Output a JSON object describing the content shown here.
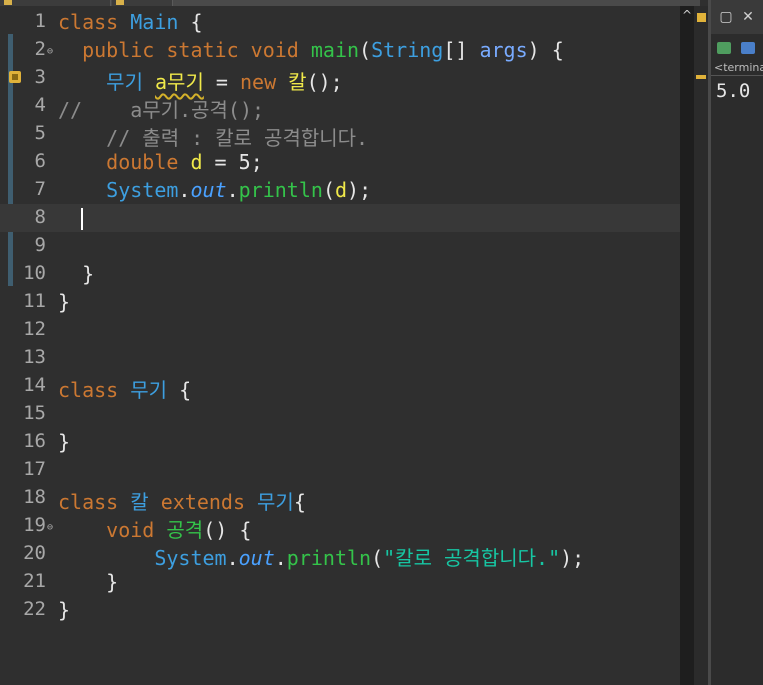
{
  "editor": {
    "lines": [
      {
        "n": "1",
        "tokens": [
          [
            "kw",
            "class "
          ],
          [
            "cls",
            "Main"
          ],
          [
            "",
            " {"
          ]
        ]
      },
      {
        "n": "2",
        "fold": true,
        "tokens": [
          [
            "",
            "  "
          ],
          [
            "kw",
            "public static void "
          ],
          [
            "fn",
            "main"
          ],
          [
            "",
            "("
          ],
          [
            "cls",
            "String"
          ],
          [
            "",
            "[] "
          ],
          [
            "param",
            "args"
          ],
          [
            "",
            ") {"
          ]
        ]
      },
      {
        "n": "3",
        "warn": true,
        "tokens": [
          [
            "",
            "    "
          ],
          [
            "cls",
            "무기 "
          ],
          [
            "var warn-ul",
            "a무기"
          ],
          [
            "",
            " = "
          ],
          [
            "kw",
            "new "
          ],
          [
            "var",
            "칼"
          ],
          [
            "",
            "();"
          ]
        ]
      },
      {
        "n": "4",
        "tokens": [
          [
            "cmt",
            "//    a무기.공격();"
          ]
        ]
      },
      {
        "n": "5",
        "tokens": [
          [
            "",
            "    "
          ],
          [
            "cmt",
            "// 출력 : 칼로 공격합니다."
          ]
        ]
      },
      {
        "n": "6",
        "tokens": [
          [
            "",
            "    "
          ],
          [
            "kw",
            "double "
          ],
          [
            "var",
            "d"
          ],
          [
            "",
            " = "
          ],
          [
            "num",
            "5"
          ],
          [
            "",
            ";"
          ]
        ]
      },
      {
        "n": "7",
        "tokens": [
          [
            "",
            "    "
          ],
          [
            "cls",
            "System"
          ],
          [
            "",
            "."
          ],
          [
            "fld",
            "out"
          ],
          [
            "",
            "."
          ],
          [
            "fn",
            "println"
          ],
          [
            "",
            "("
          ],
          [
            "var",
            "d"
          ],
          [
            "",
            ");"
          ]
        ]
      },
      {
        "n": "8",
        "current": true,
        "tokens": []
      },
      {
        "n": "9",
        "tokens": []
      },
      {
        "n": "10",
        "tokens": [
          [
            "",
            "  }"
          ]
        ]
      },
      {
        "n": "11",
        "tokens": [
          [
            "",
            "}"
          ]
        ]
      },
      {
        "n": "12",
        "tokens": []
      },
      {
        "n": "13",
        "tokens": []
      },
      {
        "n": "14",
        "tokens": [
          [
            "kw",
            "class "
          ],
          [
            "cls",
            "무기"
          ],
          [
            "",
            " {"
          ]
        ]
      },
      {
        "n": "15",
        "tokens": []
      },
      {
        "n": "16",
        "tokens": [
          [
            "",
            "}"
          ]
        ]
      },
      {
        "n": "17",
        "tokens": []
      },
      {
        "n": "18",
        "tokens": [
          [
            "kw",
            "class "
          ],
          [
            "cls",
            "칼"
          ],
          [
            "kw",
            " extends "
          ],
          [
            "cls",
            "무기"
          ],
          [
            "",
            "{"
          ]
        ]
      },
      {
        "n": "19",
        "fold": true,
        "tokens": [
          [
            "",
            "    "
          ],
          [
            "kw",
            "void "
          ],
          [
            "fn",
            "공격"
          ],
          [
            "",
            "() {"
          ]
        ]
      },
      {
        "n": "20",
        "tokens": [
          [
            "",
            "        "
          ],
          [
            "cls",
            "System"
          ],
          [
            "",
            "."
          ],
          [
            "fld",
            "out"
          ],
          [
            "",
            "."
          ],
          [
            "fn",
            "println"
          ],
          [
            "",
            "("
          ],
          [
            "str",
            "\"칼로 공격합니다.\""
          ],
          [
            "",
            ");"
          ]
        ]
      },
      {
        "n": "21",
        "tokens": [
          [
            "",
            "    }"
          ]
        ]
      },
      {
        "n": "22",
        "tokens": [
          [
            "",
            "}"
          ]
        ]
      }
    ]
  },
  "scrollbar": {
    "up_arrow": "^"
  },
  "console": {
    "header_label": "<terminated>",
    "output": "5.0",
    "minimize_icon": "▢",
    "close_icon": "✕"
  },
  "colors": {
    "background": "#2f2f2f",
    "keyword": "#cc7832",
    "type": "#3d9fe0",
    "method": "#34c34a",
    "variable": "#f0e94a",
    "comment": "#8c8c8c",
    "string": "#17c6a3"
  }
}
